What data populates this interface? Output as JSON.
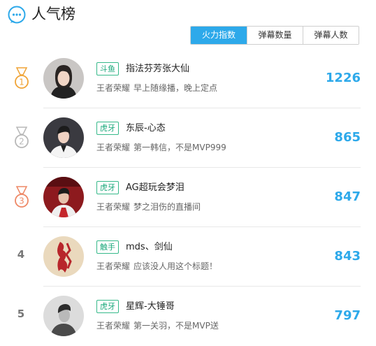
{
  "header": {
    "title": "人气榜",
    "icon": "chat-bubble-icon"
  },
  "tabs": [
    {
      "label": "火力指数",
      "active": true
    },
    {
      "label": "弹幕数量",
      "active": false
    },
    {
      "label": "弹幕人数",
      "active": false
    }
  ],
  "colors": {
    "accent": "#2da9ea",
    "tag_green": "#19a87a",
    "gold": "#f0a437",
    "silver": "#b8b8b8",
    "bronze": "#ee8866"
  },
  "rankings": [
    {
      "rank": "1",
      "medal": "gold",
      "platform": "斗鱼",
      "name": "指法芬芳张大仙",
      "game": "王者荣耀",
      "desc": "早上随缘播，晚上定点",
      "score": "1226"
    },
    {
      "rank": "2",
      "medal": "silver",
      "platform": "虎牙",
      "name": "东辰-心态",
      "game": "王者荣耀",
      "desc": "第一韩信，不是MVP999",
      "score": "865"
    },
    {
      "rank": "3",
      "medal": "bronze",
      "platform": "虎牙",
      "name": "AG超玩会梦泪",
      "game": "王者荣耀",
      "desc": "梦之泪伤的直播间",
      "score": "847"
    },
    {
      "rank": "4",
      "medal": "",
      "platform": "触手",
      "name": "mds、剑仙",
      "game": "王者荣耀",
      "desc": "应该没人用这个标题！",
      "score": "843"
    },
    {
      "rank": "5",
      "medal": "",
      "platform": "虎牙",
      "name": "星辉-大锤哥",
      "game": "王者荣耀",
      "desc": "第一关羽，不是MVP送",
      "score": "797"
    }
  ]
}
